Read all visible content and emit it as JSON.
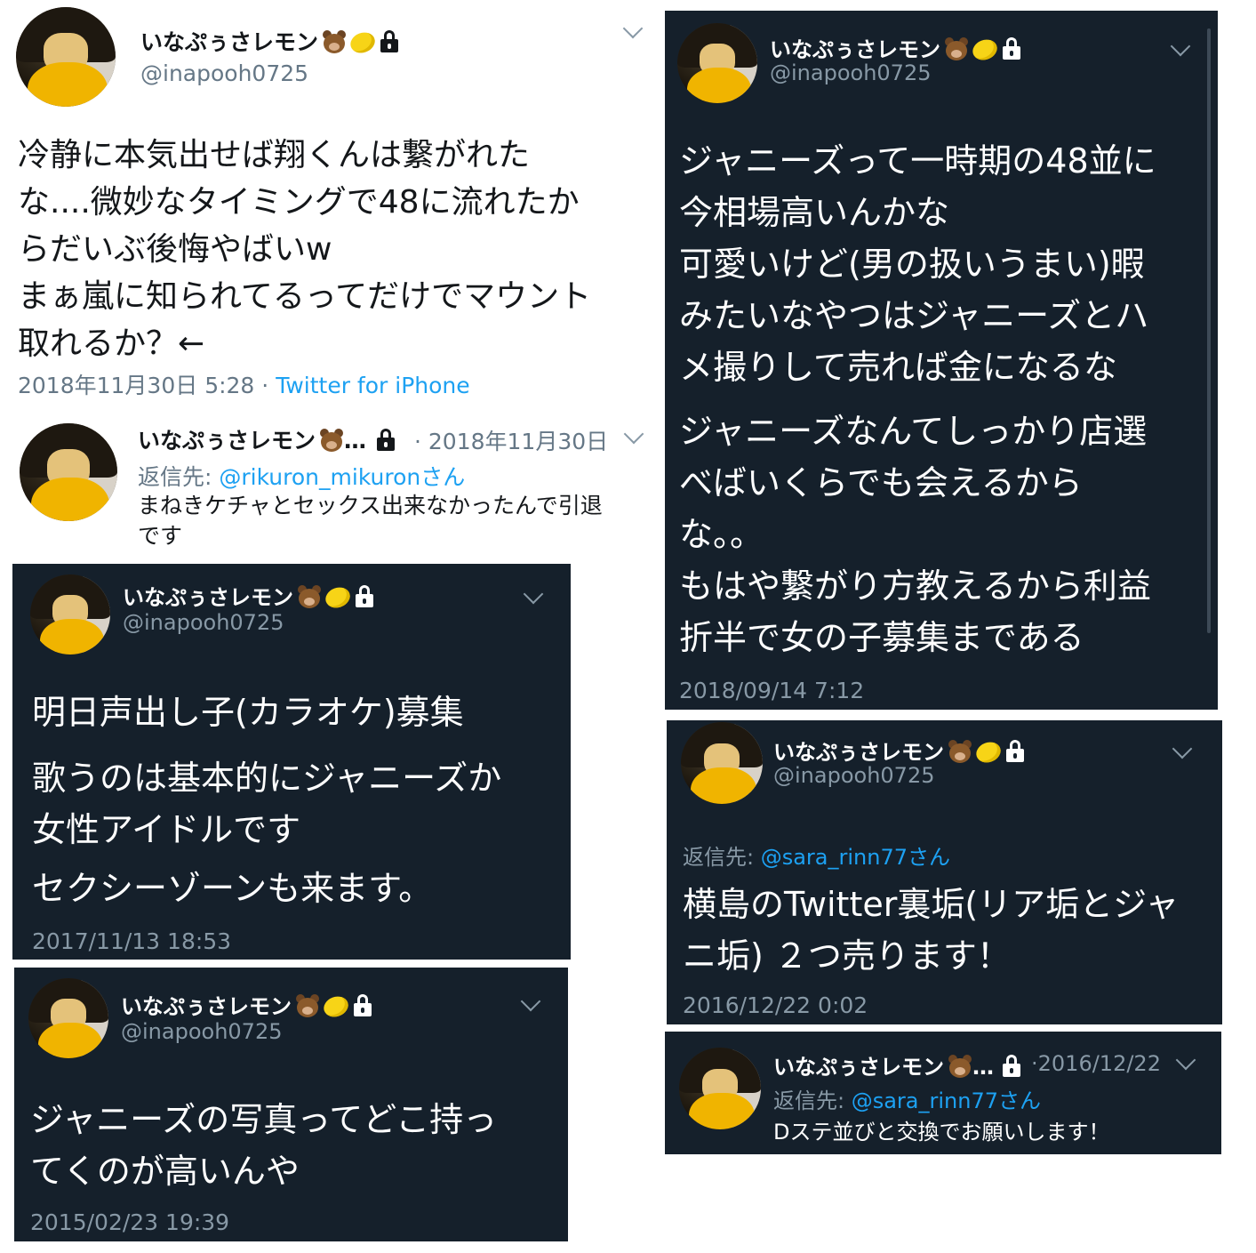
{
  "user": {
    "display_name": "いなぷぅさレモン",
    "display_name_trunc": "いなぷぅさレモン",
    "ellipsis": "…",
    "handle": "@inapooh0725"
  },
  "icons": {
    "bear": "bear-face-emoji",
    "lemon": "lemon-emoji",
    "lock": "lock-icon",
    "chevron": "chevron-down-icon"
  },
  "colors": {
    "dark_bg": "#15202b",
    "link": "#1da1f2",
    "muted_dark": "#8899a6",
    "muted_light": "#657786"
  },
  "tweets": {
    "t1": {
      "text": "冷静に本気出せば翔くんは繋がれた\nな....微妙なタイミングで48に流れたか\nらだいぶ後悔やばいw\nまぁ嵐に知られてるってだけでマウント\n取れるか？←",
      "date": "2018年11月30日 5:28",
      "sep": " · ",
      "source": "Twitter for iPhone"
    },
    "t2": {
      "date": "· 2018年11月30日",
      "reply_label": "返信先: ",
      "reply_to": "@rikuron_mikuronさん",
      "text": "まねきケチャとセックス出来なかったんで引退\nです"
    },
    "t3": {
      "text": "明日声出し子(カラオケ)募集",
      "text2": "歌うのは基本的にジャニーズか\n女性アイドルです",
      "text3": "セクシーゾーンも来ます。",
      "date": "2017/11/13 18:53"
    },
    "t4": {
      "text": "ジャニーズの写真ってどこ持っ\nてくのが高いんや",
      "date": "2015/02/23 19:39"
    },
    "t5": {
      "text": "ジャニーズって一時期の48並に\n今相場高いんかな\n可愛いけど(男の扱いうまい)暇\nみたいなやつはジャニーズとハ\nメ撮りして売れば金になるな",
      "text2": "ジャニーズなんてしっかり店選\nべばいくらでも会えるから\nな。。\nもはや繋がり方教えるから利益\n折半で女の子募集まである",
      "date": "2018/09/14 7:12"
    },
    "t6": {
      "reply_label": "返信先: ",
      "reply_to": "@sara_rinn77さん",
      "text": "横島のTwitter裏垢(リア垢とジャ\nニ垢) ２つ売ります！",
      "date": "2016/12/22 0:02"
    },
    "t7": {
      "date": "·2016/12/22",
      "reply_label": "返信先: ",
      "reply_to": "@sara_rinn77さん",
      "text": "Dステ並びと交換でお願いします！"
    }
  }
}
